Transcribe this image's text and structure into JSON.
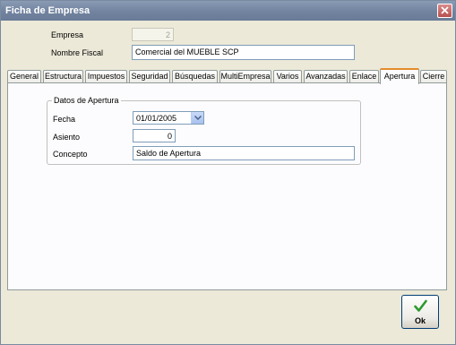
{
  "window": {
    "title": "Ficha de Empresa"
  },
  "header": {
    "empresa_label": "Empresa",
    "empresa_value": "2",
    "nombre_fiscal_label": "Nombre Fiscal",
    "nombre_fiscal_value": "Comercial del MUEBLE SCP"
  },
  "tabs": [
    {
      "label": "General"
    },
    {
      "label": "Estructura"
    },
    {
      "label": "Impuestos"
    },
    {
      "label": "Seguridad"
    },
    {
      "label": "Búsquedas"
    },
    {
      "label": "MultiEmpresa"
    },
    {
      "label": "Varios"
    },
    {
      "label": "Avanzadas"
    },
    {
      "label": "Enlace"
    },
    {
      "label": "Apertura",
      "active": true
    },
    {
      "label": "Cierre"
    }
  ],
  "apertura": {
    "group_title": "Datos de Apertura",
    "fecha_label": "Fecha",
    "fecha_value": "01/01/2005",
    "asiento_label": "Asiento",
    "asiento_value": "0",
    "concepto_label": "Concepto",
    "concepto_value": "Saldo de Apertura"
  },
  "footer": {
    "ok_label": "Ok"
  },
  "icons": {
    "close": "close-icon",
    "ok": "checkmark-icon",
    "dropdown": "chevron-down-icon"
  },
  "colors": {
    "titlebar": "#71839f",
    "active_tab_accent": "#e68b2c",
    "ok_check": "#2e9a2e"
  }
}
